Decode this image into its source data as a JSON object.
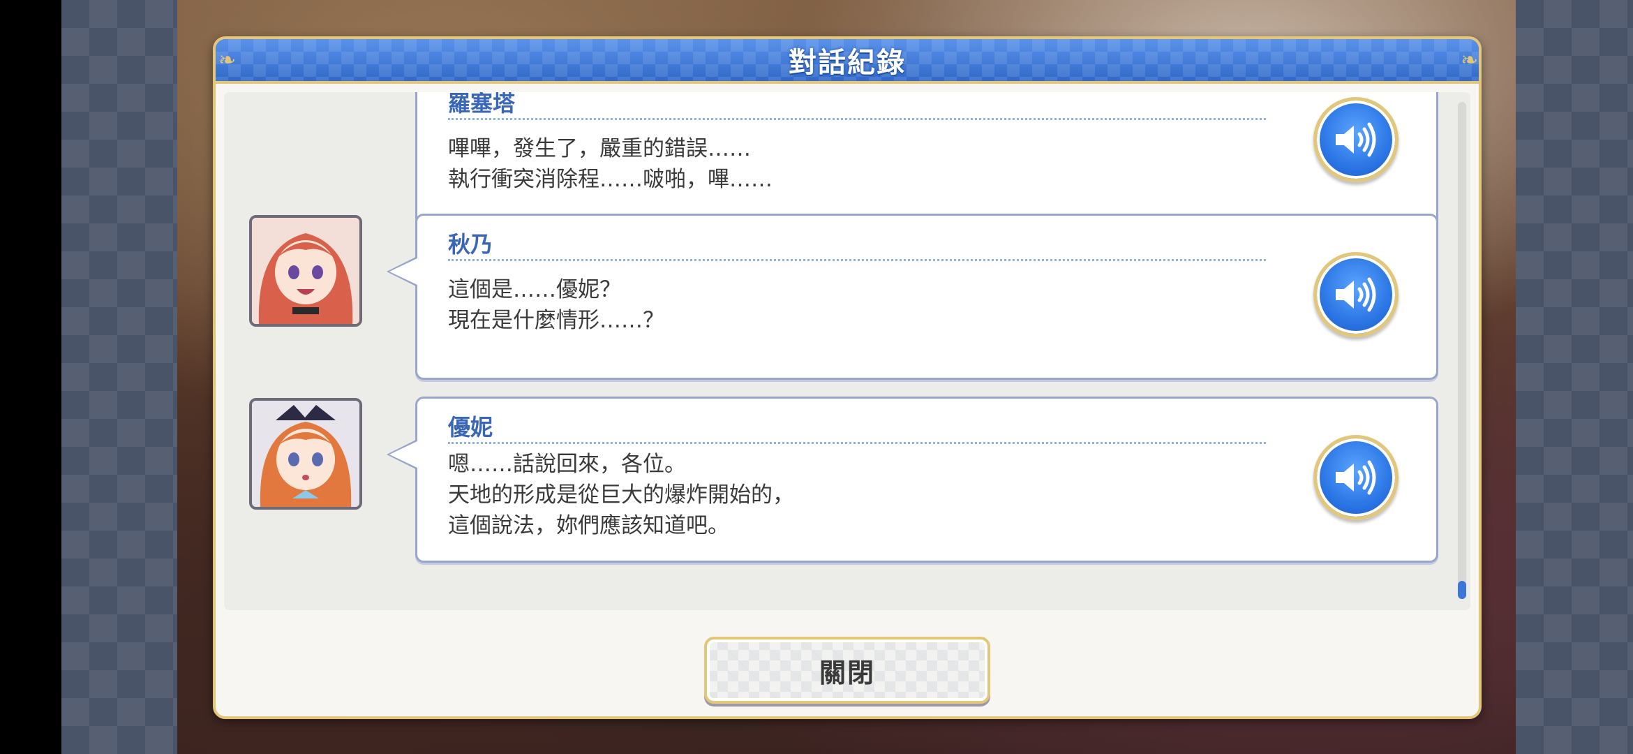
{
  "window": {
    "title": "對話紀錄"
  },
  "entries": [
    {
      "speaker": "羅塞塔",
      "lines": [
        "嗶嗶，發生了，嚴重的錯誤……",
        "執行衝突消除程……啵啪，嗶……"
      ],
      "has_portrait": false,
      "voice_icon": "speaker-sound-icon"
    },
    {
      "speaker": "秋乃",
      "lines": [
        "這個是……優妮？",
        "現在是什麼情形……？"
      ],
      "has_portrait": true,
      "voice_icon": "speaker-sound-icon"
    },
    {
      "speaker": "優妮",
      "lines": [
        "嗯……話說回來，各位。",
        "天地的形成是從巨大的爆炸開始的，",
        "這個說法，妳們應該知道吧。"
      ],
      "has_portrait": true,
      "voice_icon": "speaker-sound-icon"
    }
  ],
  "footer": {
    "close_label": "關閉"
  },
  "colors": {
    "header_blue": "#3f7ad8",
    "gold_border": "#e2c77a",
    "speaker_name": "#3a66b8",
    "voice_button": "#2a74e4"
  }
}
